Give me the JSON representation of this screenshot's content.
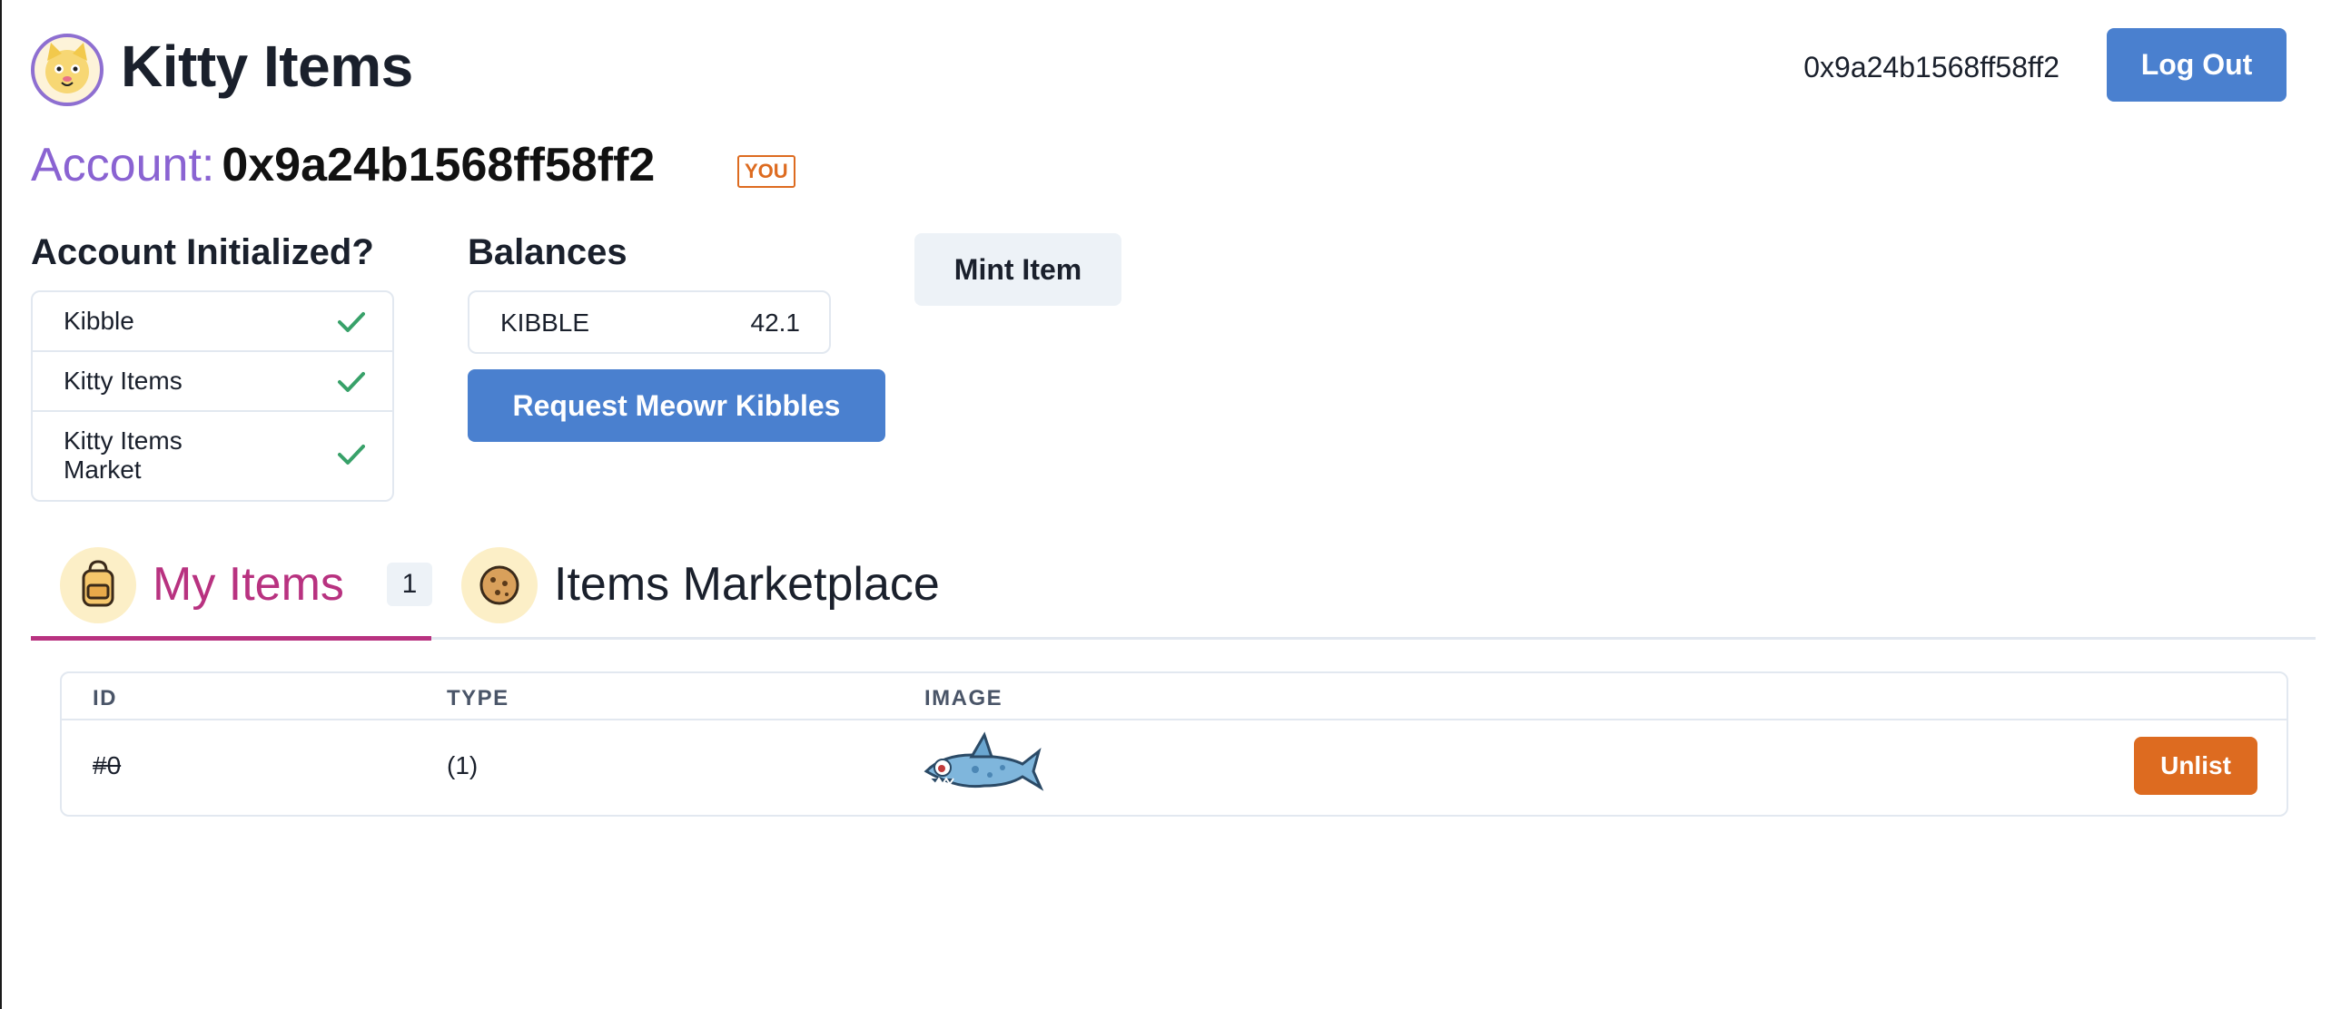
{
  "header": {
    "app_title": "Kitty Items",
    "address": "0x9a24b1568ff58ff2",
    "logout_label": "Log Out"
  },
  "account": {
    "label": "Account:",
    "address": "0x9a24b1568ff58ff2",
    "you_badge": "YOU"
  },
  "initialized": {
    "heading": "Account Initialized?",
    "items": [
      {
        "label": "Kibble",
        "status": "initialized"
      },
      {
        "label": "Kitty Items",
        "status": "initialized"
      },
      {
        "label": "Kitty Items Market",
        "status": "initialized"
      }
    ]
  },
  "balances": {
    "heading": "Balances",
    "items": [
      {
        "token": "KIBBLE",
        "amount": "42.1"
      }
    ],
    "request_label": "Request Meowr Kibbles"
  },
  "mint": {
    "label": "Mint Item"
  },
  "tabs": [
    {
      "label": "My Items",
      "count": "1",
      "active": true,
      "icon": "backpack-icon"
    },
    {
      "label": "Items Marketplace",
      "active": false,
      "icon": "cookie-icon"
    }
  ],
  "table": {
    "columns": [
      "ID",
      "TYPE",
      "IMAGE"
    ],
    "rows": [
      {
        "id": "#0",
        "type": "(1)",
        "image": "shark-icon",
        "action_label": "Unlist"
      }
    ]
  },
  "colors": {
    "accent_blue": "#4a80cf",
    "account_purple": "#8a63d2",
    "active_tab_pink": "#b83280",
    "orange": "#dd6b20",
    "check_green": "#38a169"
  }
}
